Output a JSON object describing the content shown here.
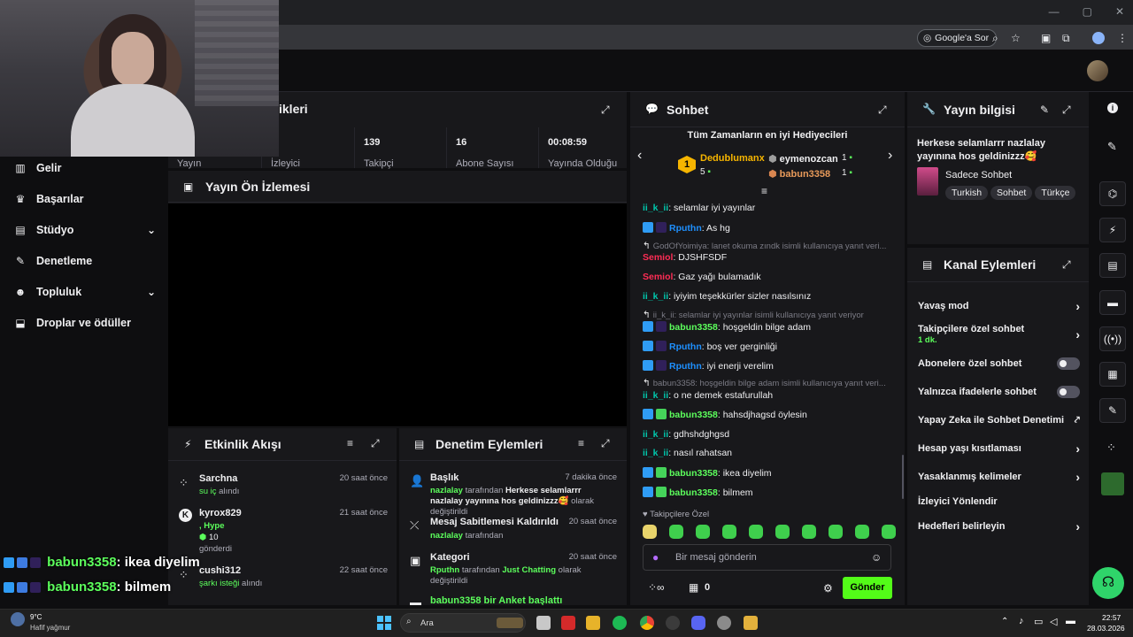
{
  "browser": {
    "google_sor": "Google'a Sor"
  },
  "nav": {
    "items": [
      {
        "label": "Gelir",
        "icon": "income-icon"
      },
      {
        "label": "Başarılar",
        "icon": "trophy-icon"
      },
      {
        "label": "Stüdyo",
        "icon": "studio-icon"
      },
      {
        "label": "Denetleme",
        "icon": "wrench-icon"
      },
      {
        "label": "Topluluk",
        "icon": "community-icon"
      },
      {
        "label": "Droplar ve ödüller",
        "icon": "drops-icon"
      }
    ]
  },
  "stats": {
    "title_partial": "ikleri",
    "columns": [
      {
        "value": "",
        "label": "Yayın"
      },
      {
        "value": "",
        "label": "İzleyici"
      },
      {
        "value": "139",
        "label": "Takipçi"
      },
      {
        "value": "16",
        "label": "Abone Sayısı"
      },
      {
        "value": "00:08:59",
        "label": "Yayında Olduğu"
      }
    ]
  },
  "preview": {
    "title": "Yayın Ön İzlemesi"
  },
  "activity": {
    "title": "Etkinlik Akışı",
    "items": [
      {
        "name": "Sarchna",
        "detail_highlight": "su iç",
        "detail_rest": " alındı",
        "time": "20 saat önce"
      },
      {
        "name": "kyrox829",
        "detail_highlight": ", Hype",
        "amount": "10",
        "detail_rest": "gönderdi",
        "time": "21 saat önce"
      },
      {
        "name": "cushi312",
        "detail_highlight": "şarkı isteği",
        "detail_rest": " alındı",
        "time": "22 saat önce"
      }
    ]
  },
  "mod_actions": {
    "title": "Denetim Eylemleri",
    "items": [
      {
        "title": "Başlık",
        "time": "7 dakika önce",
        "user": "nazlalay",
        "mid": " tarafından ",
        "value": "Herkese selamlarrr nazlalay yayınına hos geldinizzz🥰",
        "end": " olarak değiştirildi"
      },
      {
        "title": "Mesaj Sabitlemesi Kaldırıldı",
        "time": "20 saat önce",
        "user": "nazlalay",
        "mid": " tarafından",
        "value": "",
        "end": ""
      },
      {
        "title": "Kategori",
        "time": "20 saat önce",
        "user": "Rputhn",
        "mid": " tarafından ",
        "value": "Just Chatting",
        "end": " olarak değiştirildi"
      },
      {
        "title": "babun3358 bir Anket başlattı",
        "time": "",
        "user": "",
        "mid": "",
        "value": "",
        "end": ""
      }
    ]
  },
  "chat": {
    "title": "Sohbet",
    "gifters_title": "Tüm Zamanların en iyi Hediyecileri",
    "gifters": [
      {
        "rank": "1",
        "name": "Dedublumanx",
        "count": "5"
      },
      {
        "rank": "2",
        "name": "eymenozcan",
        "count": "1"
      },
      {
        "rank": "3",
        "name": "babun3358",
        "count": "1"
      }
    ],
    "messages": [
      {
        "type": "msg",
        "badges": [],
        "user": "ii_k_ii",
        "color": "#00c7ac",
        "text": "selamlar iyi yayınlar"
      },
      {
        "type": "msg",
        "badges": [
          "b-blue",
          "b-purple"
        ],
        "user": "Rputhn",
        "color": "#1e90ff",
        "text": "As hg"
      },
      {
        "type": "reply",
        "text": "GodOfYoimiya: lanet okuma zındk isimli kullanıcıya yanıt veri..."
      },
      {
        "type": "msg",
        "badges": [],
        "user": "Semiol",
        "color": "#ff2d55",
        "text": "DJSHFSDF"
      },
      {
        "type": "msg",
        "badges": [],
        "user": "Semiol",
        "color": "#ff2d55",
        "text": "Gaz yağı bulamadık"
      },
      {
        "type": "msg",
        "badges": [],
        "user": "ii_k_ii",
        "color": "#00c7ac",
        "text": "iyiyim teşekkürler sizler nasılsınız"
      },
      {
        "type": "reply",
        "text": "ii_k_ii: selamlar iyi yayınlar isimli kullanıcıya yanıt veriyor"
      },
      {
        "type": "msg",
        "badges": [
          "b-blue",
          "b-purple"
        ],
        "user": "babun3358",
        "color": "#5cff5c",
        "text": "hoşgeldin bilge adam"
      },
      {
        "type": "msg",
        "badges": [
          "b-blue",
          "b-purple"
        ],
        "user": "Rputhn",
        "color": "#1e90ff",
        "text": "boş ver gerginliği"
      },
      {
        "type": "msg",
        "badges": [
          "b-blue",
          "b-purple"
        ],
        "user": "Rputhn",
        "color": "#1e90ff",
        "text": "iyi enerji verelim"
      },
      {
        "type": "reply",
        "text": "babun3358: hoşgeldin bilge adam isimli kullanıcıya yanıt veri..."
      },
      {
        "type": "msg",
        "badges": [],
        "user": "ii_k_ii",
        "color": "#00c7ac",
        "text": "o ne demek estafurullah"
      },
      {
        "type": "msg",
        "badges": [
          "b-blue",
          "b-green"
        ],
        "user": "babun3358",
        "color": "#5cff5c",
        "text": "hahsdjhagsd öylesin"
      },
      {
        "type": "msg",
        "badges": [],
        "user": "ii_k_ii",
        "color": "#00c7ac",
        "text": "gdhshdghgsd"
      },
      {
        "type": "msg",
        "badges": [],
        "user": "ii_k_ii",
        "color": "#00c7ac",
        "text": "nasıl rahatsan"
      },
      {
        "type": "msg",
        "badges": [
          "b-blue",
          "b-green"
        ],
        "user": "babun3358",
        "color": "#5cff5c",
        "text": "ikea diyelim"
      },
      {
        "type": "msg",
        "badges": [
          "b-blue",
          "b-green"
        ],
        "user": "babun3358",
        "color": "#5cff5c",
        "text": "bilmem"
      }
    ],
    "followers_only": "Takipçilere Özel",
    "input_placeholder": "Bir mesaj gönderin",
    "points": "0",
    "send_label": "Gönder"
  },
  "stream_info": {
    "title": "Yayın bilgisi",
    "stream_title": "Herkese selamlarrr nazlalay yayınına hos geldinizzz🥰",
    "category": "Sadece Sohbet",
    "tags": [
      "Turkish",
      "Sohbet",
      "Türkçe"
    ]
  },
  "channel_actions": {
    "title": "Kanal Eylemleri",
    "rows": [
      {
        "label": "Yavaş mod",
        "control": "arrow",
        "sub": ""
      },
      {
        "label": "Takipçilere özel sohbet",
        "control": "arrow",
        "sub": "1 dk."
      },
      {
        "label": "Abonelere özel sohbet",
        "control": "toggle",
        "sub": ""
      },
      {
        "label": "Yalnızca ifadelerle sohbet",
        "control": "toggle",
        "sub": ""
      },
      {
        "label": "Yapay Zeka ile Sohbet Denetimi",
        "control": "external",
        "sub": ""
      },
      {
        "label": "Hesap yaşı kısıtlaması",
        "control": "arrow",
        "sub": ""
      },
      {
        "label": "Yasaklanmış kelimeler",
        "control": "arrow",
        "sub": ""
      },
      {
        "label": "İzleyici Yönlendir",
        "control": "none",
        "sub": ""
      },
      {
        "label": "Hedefleri belirleyin",
        "control": "arrow",
        "sub": ""
      }
    ]
  },
  "overlay": {
    "lines": [
      {
        "user": "babun3358",
        "text": ": ikea diyelim"
      },
      {
        "user": "babun3358",
        "text": ": bilmem"
      }
    ]
  },
  "taskbar": {
    "temp": "9°C",
    "weather": "Hafif yağmur",
    "search": "Ara",
    "time": "22:57",
    "date": "28.03.2026"
  },
  "colors": {
    "accent_green": "#53fc18",
    "panel": "#18181b",
    "background": "#0e0e10"
  }
}
